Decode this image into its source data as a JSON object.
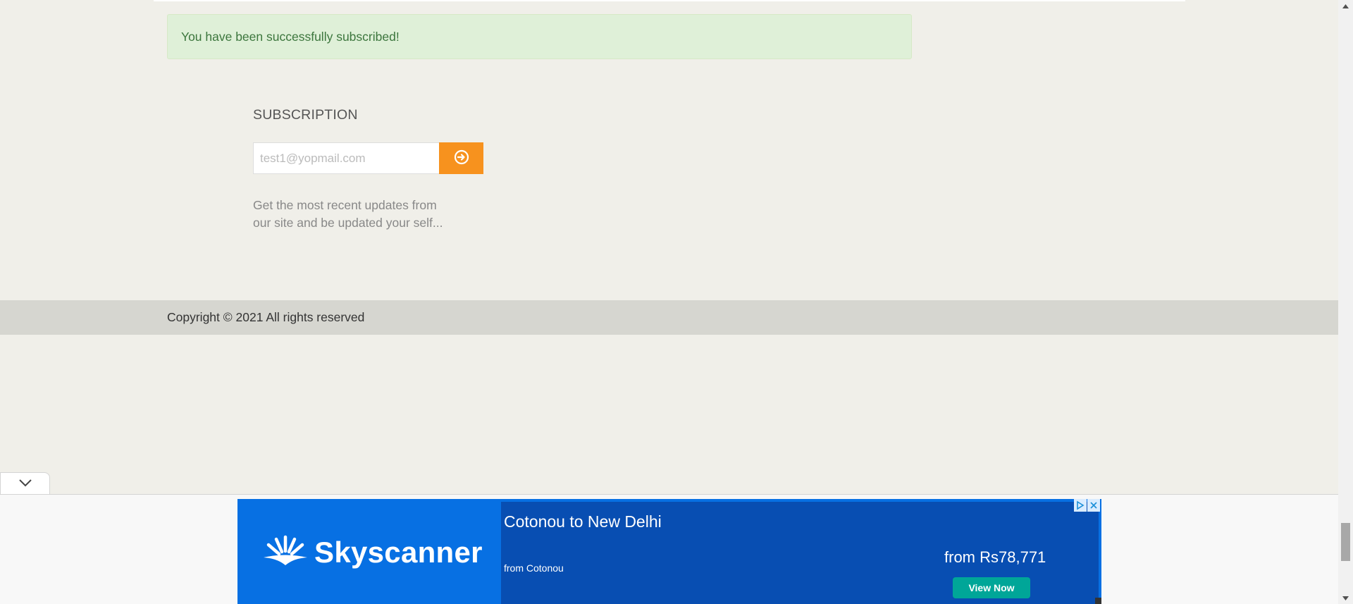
{
  "alert": {
    "message": "You have been successfully subscribed!"
  },
  "subscription": {
    "title": "SUBSCRIPTION",
    "email_value": "test1@yopmail.com",
    "submit_icon": "arrow-circle-right-icon",
    "description_line1": "Get the most recent updates from",
    "description_line2": "our site and be updated your self..."
  },
  "footer": {
    "copyright": "Copyright © 2021 All rights reserved"
  },
  "ad": {
    "collapse_icon": "chevron-down-icon",
    "brand": "Skyscanner",
    "route": "Cotonou to New Delhi",
    "origin": "from Cotonou",
    "price": "from Rs78,771",
    "cta": "View Now",
    "colors": {
      "banner": "#0770e3",
      "panel": "#084eb2",
      "cta": "#00a698"
    }
  },
  "colors": {
    "page_background": "#f0efe9",
    "alert_background": "#dff0d8",
    "alert_text": "#3c763d",
    "subscribe_button": "#f7921e",
    "footer_bar": "#d6d6d0"
  }
}
